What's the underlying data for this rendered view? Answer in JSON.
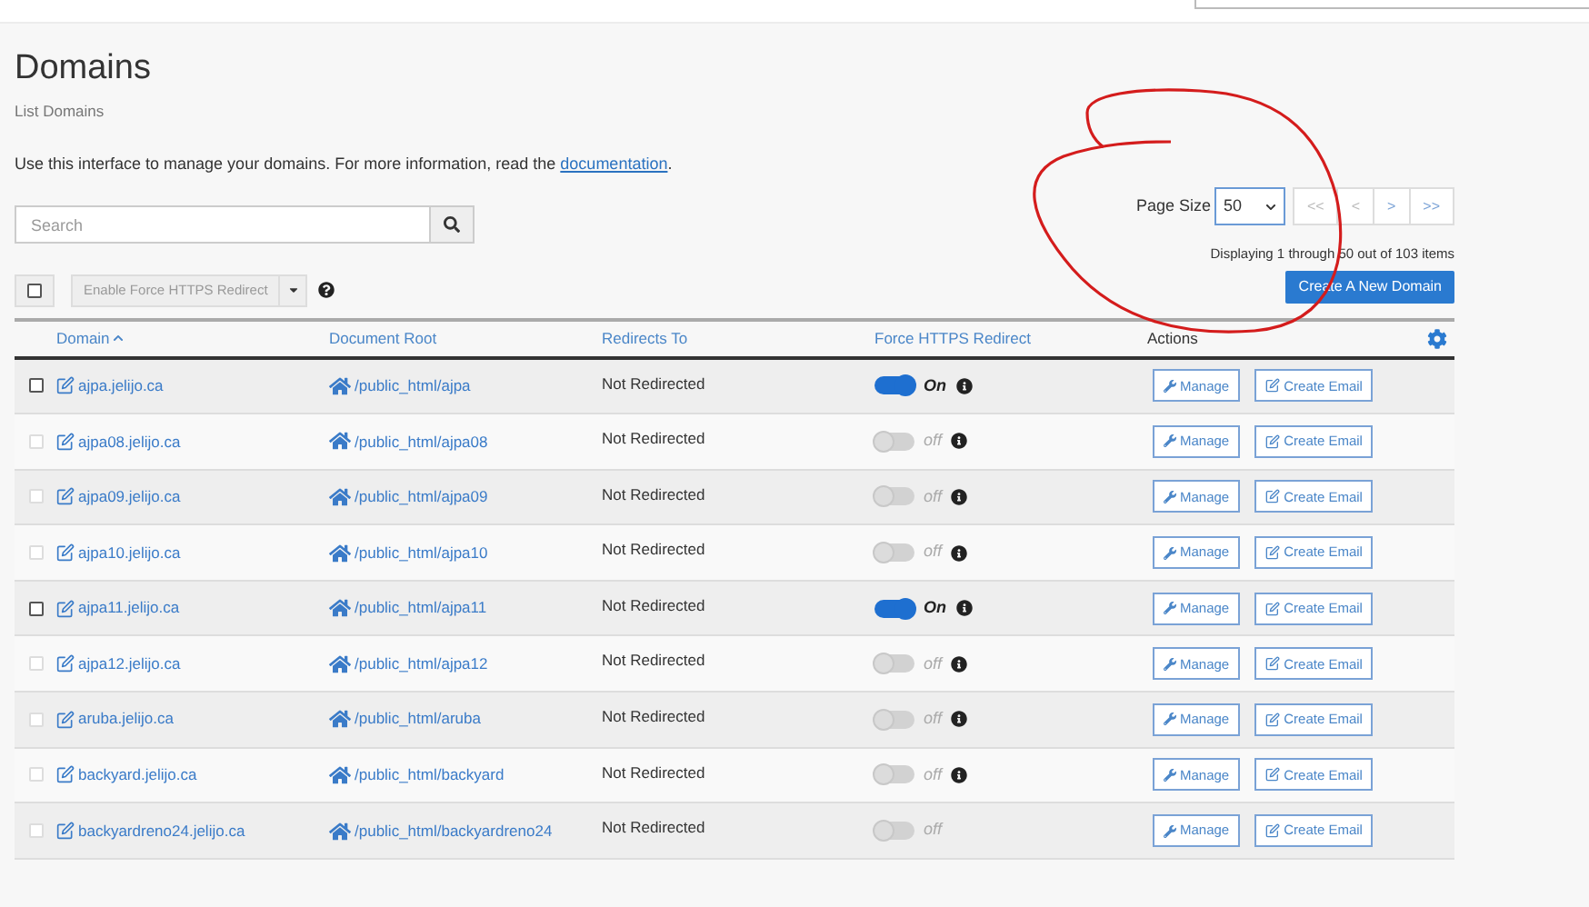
{
  "page": {
    "title": "Domains",
    "subtitle": "List Domains",
    "intro": "Use this interface to manage your domains. For more information, read the",
    "link": "documentation",
    "intro_end": "."
  },
  "search": {
    "placeholder": "Search"
  },
  "bulk": {
    "checked": false,
    "action": "Enable Force HTTPS Redirect"
  },
  "pagination": {
    "label": "Page Size",
    "page_size": "50",
    "buttons": [
      "<<",
      "<",
      ">",
      ">>"
    ],
    "summary": "Displaying 1 through 50 out of 103 items"
  },
  "create_button": "Create A New Domain",
  "table": {
    "columns": [
      {
        "label": "Domain",
        "sorted": true
      },
      {
        "label": "Document Root",
        "sorted": false
      },
      {
        "label": "Redirects To",
        "sorted": false
      },
      {
        "label": "Force HTTPS Redirect",
        "sorted": false
      },
      {
        "label": "Actions",
        "sorted": false
      }
    ],
    "rows": [
      {
        "checkbox_disabled": false,
        "domain": "ajpa.jelijo.ca",
        "root": "/public_html/ajpa",
        "redirect": "Not Redirected",
        "https_on": true,
        "https_label": "On",
        "info": true,
        "actions": [
          "Manage",
          "Create Email"
        ]
      },
      {
        "checkbox_disabled": true,
        "domain": "ajpa08.jelijo.ca",
        "root": "/public_html/ajpa08",
        "redirect": "Not Redirected",
        "https_on": false,
        "https_label": "off",
        "info": true,
        "actions": [
          "Manage",
          "Create Email"
        ]
      },
      {
        "checkbox_disabled": true,
        "domain": "ajpa09.jelijo.ca",
        "root": "/public_html/ajpa09",
        "redirect": "Not Redirected",
        "https_on": false,
        "https_label": "off",
        "info": true,
        "actions": [
          "Manage",
          "Create Email"
        ]
      },
      {
        "checkbox_disabled": true,
        "domain": "ajpa10.jelijo.ca",
        "root": "/public_html/ajpa10",
        "redirect": "Not Redirected",
        "https_on": false,
        "https_label": "off",
        "info": true,
        "actions": [
          "Manage",
          "Create Email"
        ]
      },
      {
        "checkbox_disabled": false,
        "domain": "ajpa11.jelijo.ca",
        "root": "/public_html/ajpa11",
        "redirect": "Not Redirected",
        "https_on": true,
        "https_label": "On",
        "info": true,
        "actions": [
          "Manage",
          "Create Email"
        ]
      },
      {
        "checkbox_disabled": true,
        "domain": "ajpa12.jelijo.ca",
        "root": "/public_html/ajpa12",
        "redirect": "Not Redirected",
        "https_on": false,
        "https_label": "off",
        "info": true,
        "actions": [
          "Manage",
          "Create Email"
        ]
      },
      {
        "checkbox_disabled": true,
        "domain": "aruba.jelijo.ca",
        "root": "/public_html/aruba",
        "redirect": "Not Redirected",
        "https_on": false,
        "https_label": "off",
        "info": true,
        "actions": [
          "Manage",
          "Create Email"
        ]
      },
      {
        "checkbox_disabled": true,
        "domain": "backyard.jelijo.ca",
        "root": "/public_html/backyard",
        "redirect": "Not Redirected",
        "https_on": false,
        "https_label": "off",
        "info": true,
        "actions": [
          "Manage",
          "Create Email"
        ]
      },
      {
        "checkbox_disabled": true,
        "domain": "backyardreno24.jelijo.ca",
        "root": "/public_html/backyardreno24",
        "redirect": "Not Redirected",
        "https_on": false,
        "https_label": "off",
        "info": false,
        "actions": [
          "Manage",
          "Create Email"
        ]
      }
    ]
  }
}
